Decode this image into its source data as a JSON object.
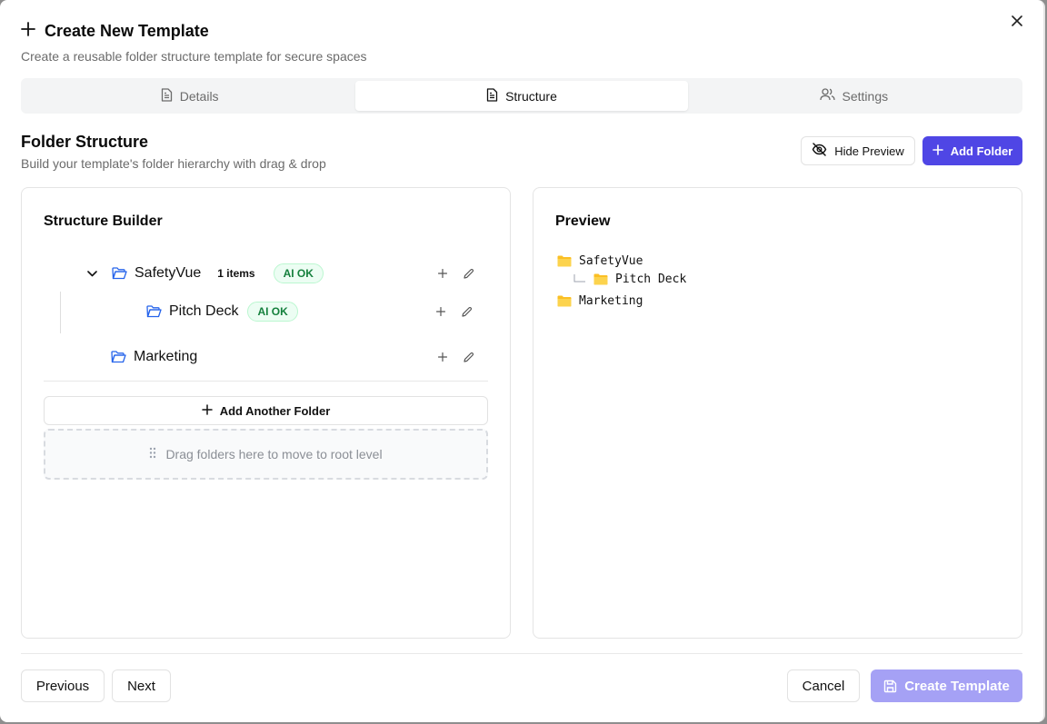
{
  "dialog": {
    "title": "Create New Template",
    "subtitle": "Create a reusable folder structure template for secure spaces"
  },
  "tabs": [
    {
      "label": "Details",
      "icon": "document-icon",
      "active": false
    },
    {
      "label": "Structure",
      "icon": "document-icon",
      "active": true
    },
    {
      "label": "Settings",
      "icon": "users-icon",
      "active": false
    }
  ],
  "section": {
    "title": "Folder Structure",
    "subtitle": "Build your template's folder hierarchy with drag & drop",
    "hide_preview_label": "Hide Preview",
    "add_folder_label": "Add Folder"
  },
  "builder": {
    "title": "Structure Builder",
    "folders": [
      {
        "name": "SafetyVue",
        "count": "1 items",
        "badge": "AI OK"
      },
      {
        "name": "Pitch Deck",
        "badge": "AI OK"
      },
      {
        "name": "Marketing"
      }
    ],
    "add_another_label": "Add Another Folder",
    "dropzone_text": "Drag folders here to move to root level"
  },
  "preview": {
    "title": "Preview",
    "items": [
      "SafetyVue",
      "Pitch Deck",
      "Marketing"
    ]
  },
  "footer": {
    "previous_label": "Previous",
    "next_label": "Next",
    "cancel_label": "Cancel",
    "create_label": "Create Template"
  },
  "colors": {
    "primary": "#4f46e5",
    "primary_disabled": "#a5a1f5",
    "folder_blue": "#2563eb",
    "folder_yellow": "#fbbf24",
    "badge_green": "#15803d"
  }
}
